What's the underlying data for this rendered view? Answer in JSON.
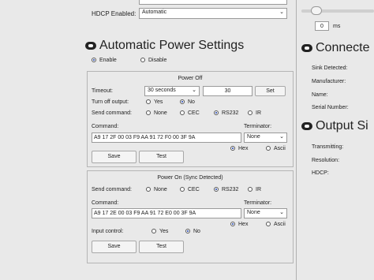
{
  "hdcp": {
    "label": "HDCP Enabled:",
    "value": "Automatic"
  },
  "auto_power": {
    "title": "Automatic Power Settings",
    "enable_label": "Enable",
    "disable_label": "Disable"
  },
  "power_off": {
    "title": "Power Off",
    "timeout_label": "Timeout:",
    "timeout_select": "30 seconds",
    "timeout_value": "30",
    "set_label": "Set",
    "turn_off_label": "Turn off output:",
    "yes_label": "Yes",
    "no_label": "No",
    "send_label": "Send command:",
    "none_label": "None",
    "cec_label": "CEC",
    "rs232_label": "RS232",
    "ir_label": "IR",
    "command_label": "Command:",
    "command_value": "A9 17 2F 00 03 F9 AA 91 72 F0 00 3F 9A",
    "terminator_label": "Terminator:",
    "terminator_value": "None",
    "hex_label": "Hex",
    "ascii_label": "Ascii",
    "save_label": "Save",
    "test_label": "Test"
  },
  "power_on": {
    "title": "Power On (Sync Detected)",
    "send_label": "Send command:",
    "none_label": "None",
    "cec_label": "CEC",
    "rs232_label": "RS232",
    "ir_label": "IR",
    "command_label": "Command:",
    "command_value": "A9 17 2E 00 03 F9 AA 91 72 E0 00 3F 9A",
    "terminator_label": "Terminator:",
    "terminator_value": "None",
    "hex_label": "Hex",
    "ascii_label": "Ascii",
    "input_control_label": "Input control:",
    "yes_label": "Yes",
    "no_label": "No",
    "save_label": "Save",
    "test_label": "Test"
  },
  "right": {
    "delay_value": "0",
    "delay_unit": "ms",
    "connected_title": "Connecte",
    "sink_detected": "Sink Detected:",
    "manufacturer": "Manufacturer:",
    "name": "Name:",
    "serial": "Serial Number:",
    "output_title": "Output Si",
    "transmitting": "Transmitting:",
    "resolution": "Resolution:",
    "hdcp": "HDCP:"
  }
}
